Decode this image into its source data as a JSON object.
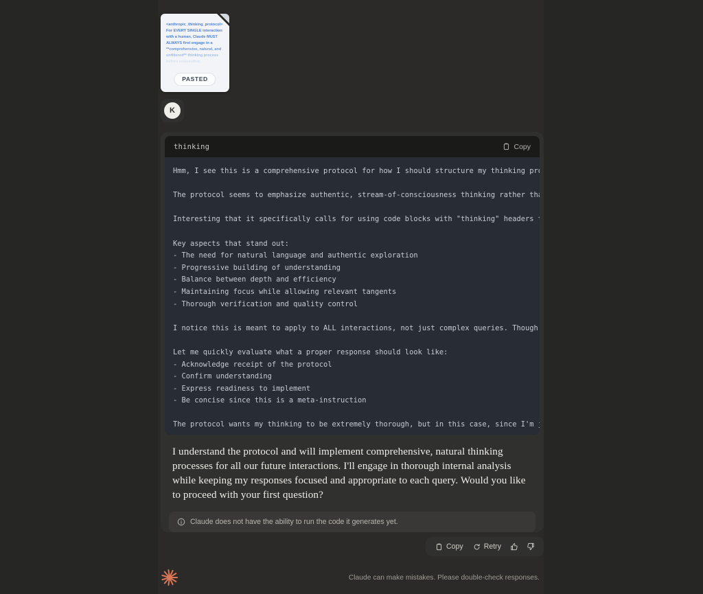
{
  "theme": {
    "page_bg": "#262624",
    "column_bg": "#2b2a28",
    "message_bg": "#30302e",
    "code_header_bg": "#1a1a19",
    "code_body_bg": "#282c34",
    "accent_orange": "#d97757",
    "code_text": "#c5cbd6",
    "doc_text_blue": "#4e83d6"
  },
  "attachment": {
    "name": "pasted-document-card",
    "preview_text": "<anthropic_thinking_protocol> For EVERY SINGLE interaction with a human, Claude MUST ALWAYS first engage in a **comprehensive, natural, and unfiltered** thinking process before responding.",
    "badge_label": "PASTED"
  },
  "user": {
    "avatar_initial": "K"
  },
  "code_block": {
    "language_label": "thinking",
    "copy_label": "Copy",
    "lines": [
      "Hmm, I see this is a comprehensive protocol for how I should structure my thinking process before responding. Let me think",
      "",
      "The protocol seems to emphasize authentic, stream-of-consciousness thinking rather than rigid, structured analysis. It wants",
      "",
      "Interesting that it specifically calls for using code blocks with \"thinking\" headers to contain the thought process. That's a",
      "",
      "Key aspects that stand out:",
      "- The need for natural language and authentic exploration",
      "- Progressive building of understanding",
      "- Balance between depth and efficiency",
      "- Maintaining focus while allowing relevant tangents",
      "- Thorough verification and quality control",
      "",
      "I notice this is meant to apply to ALL interactions, not just complex queries. Though the depth should adapt to the query",
      "",
      "Let me quickly evaluate what a proper response should look like:",
      "- Acknowledge receipt of the protocol",
      "- Confirm understanding",
      "- Express readiness to implement",
      "- Be concise since this is a meta-instruction",
      "",
      "The protocol wants my thinking to be extremely thorough, but in this case, since I'm just confirming receipt, a moderate"
    ],
    "scrollbar": {
      "name": "horizontal-scrollbar",
      "thumb_percent": 38,
      "position_percent": 0
    }
  },
  "assistant_response": {
    "text": "I understand the protocol and will implement comprehensive, natural thinking processes for all our future interactions. I'll engage in thorough internal analysis while keeping my responses focused and appropriate to each query. Would you like to proceed with your first question?"
  },
  "notice": {
    "text": "Claude does not have the ability to run the code it generates yet."
  },
  "actions": {
    "copy_label": "Copy",
    "retry_label": "Retry",
    "thumbs_up_name": "thumbs-up-icon",
    "thumbs_down_name": "thumbs-down-icon"
  },
  "footer": {
    "note": "Claude can make mistakes. Please double-check responses."
  }
}
